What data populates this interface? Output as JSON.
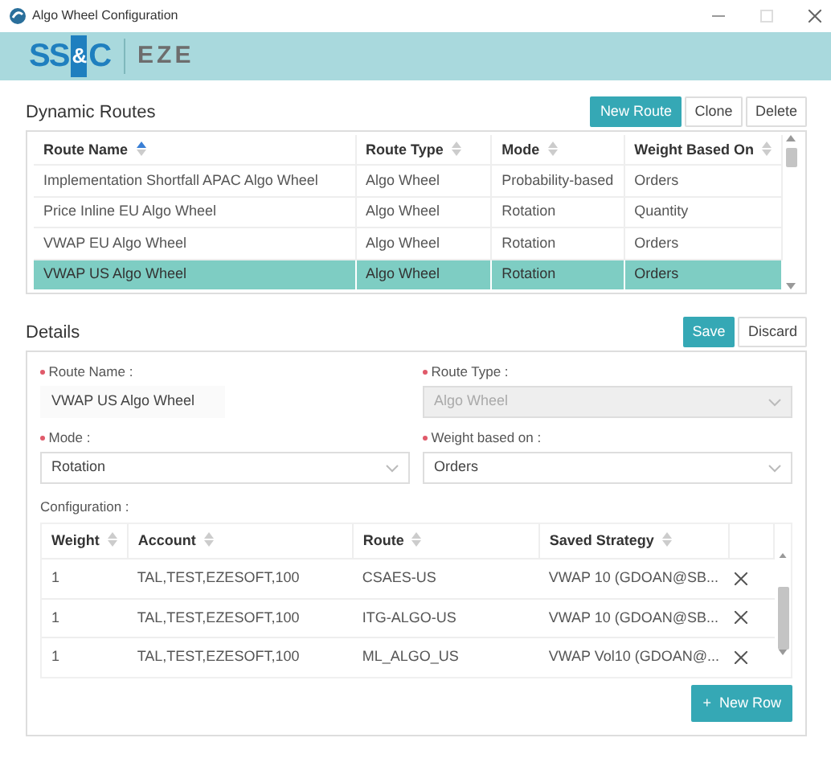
{
  "window": {
    "title": "Algo Wheel Configuration"
  },
  "banner": {
    "logo_parts": [
      "SS",
      "&",
      "C"
    ],
    "product": "EZE"
  },
  "routes": {
    "title": "Dynamic Routes",
    "buttons": [
      {
        "label": "New Route",
        "kind": "primary"
      },
      {
        "label": "Clone",
        "kind": "plain"
      },
      {
        "label": "Delete",
        "kind": "plain"
      }
    ],
    "columns": [
      {
        "label": "Route Name",
        "sorted": true
      },
      {
        "label": "Route Type",
        "sorted": false
      },
      {
        "label": "Mode",
        "sorted": false
      },
      {
        "label": "Weight Based On",
        "sorted": false
      }
    ],
    "rows": [
      {
        "cells": [
          "Implementation Shortfall APAC Algo Wheel",
          "Algo Wheel",
          "Probability-based",
          "Orders"
        ],
        "selected": false
      },
      {
        "cells": [
          "Price Inline EU Algo Wheel",
          "Algo Wheel",
          "Rotation",
          "Quantity"
        ],
        "selected": false
      },
      {
        "cells": [
          "VWAP EU Algo Wheel",
          "Algo Wheel",
          "Rotation",
          "Orders"
        ],
        "selected": false
      },
      {
        "cells": [
          "VWAP US Algo Wheel",
          "Algo Wheel",
          "Rotation",
          "Orders"
        ],
        "selected": true
      }
    ]
  },
  "details": {
    "title": "Details",
    "buttons": [
      {
        "label": "Save",
        "kind": "primary"
      },
      {
        "label": "Discard",
        "kind": "plain"
      }
    ],
    "fields": [
      {
        "label": "Route Name :",
        "value": "VWAP US Algo Wheel",
        "kind": "text",
        "disabled": false,
        "required": true
      },
      {
        "label": "Route Type :",
        "value": "Algo Wheel",
        "kind": "select",
        "disabled": true,
        "required": true
      },
      {
        "label": "Mode :",
        "value": "Rotation",
        "kind": "select",
        "disabled": false,
        "required": true
      },
      {
        "label": "Weight based on :",
        "value": "Orders",
        "kind": "select",
        "disabled": false,
        "required": true
      }
    ],
    "configuration": {
      "label": "Configuration :",
      "columns": [
        {
          "label": "Weight",
          "sorted": false
        },
        {
          "label": "Account",
          "sorted": false
        },
        {
          "label": "Route",
          "sorted": false
        },
        {
          "label": "Saved Strategy",
          "sorted": false
        }
      ],
      "rows": [
        {
          "cells": [
            "1",
            "TAL,TEST,EZESOFT,100",
            "CSAES-US",
            "VWAP 10 (GDOAN@SB..."
          ]
        },
        {
          "cells": [
            "1",
            "TAL,TEST,EZESOFT,100",
            "ITG-ALGO-US",
            "VWAP 10 (GDOAN@SB..."
          ]
        },
        {
          "cells": [
            "1",
            "TAL,TEST,EZESOFT,100",
            "ML_ALGO_US",
            "VWAP Vol10 (GDOAN@..."
          ]
        }
      ],
      "add_button": {
        "icon": "+",
        "label": "New Row"
      }
    }
  }
}
